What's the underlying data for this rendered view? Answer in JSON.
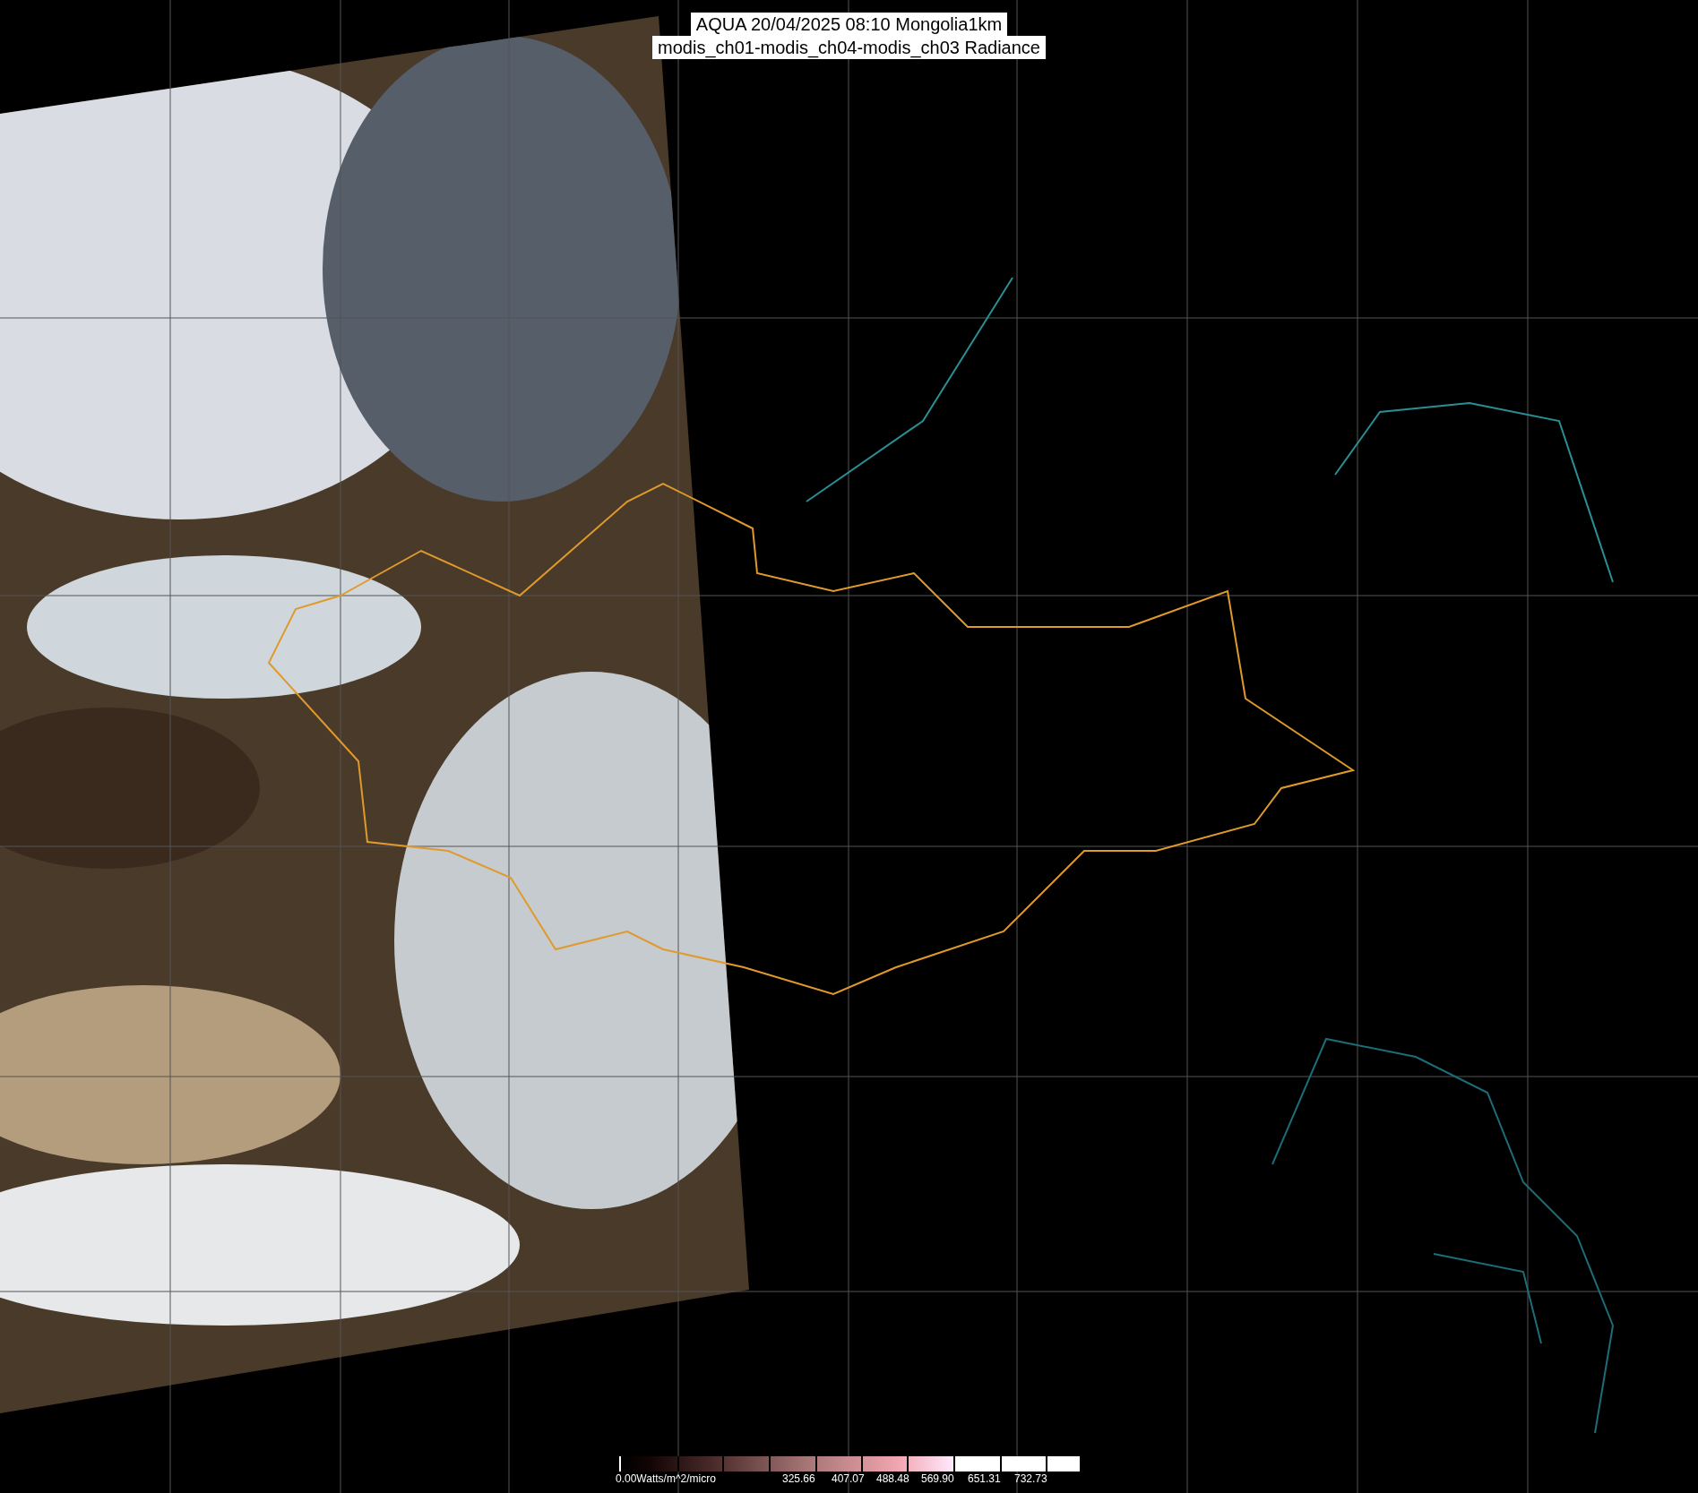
{
  "title": {
    "lines": [
      "AQUA 20/04/2025 08:10 Mongolia1km",
      "modis_ch01-modis_ch04-modis_ch03 Radiance"
    ]
  },
  "color_scale": {
    "start_label": "0.00Watts/m^2/micro",
    "tick_labels": [
      "325.66",
      "407.07",
      "488.48",
      "569.90",
      "651.31",
      "732.73"
    ]
  }
}
